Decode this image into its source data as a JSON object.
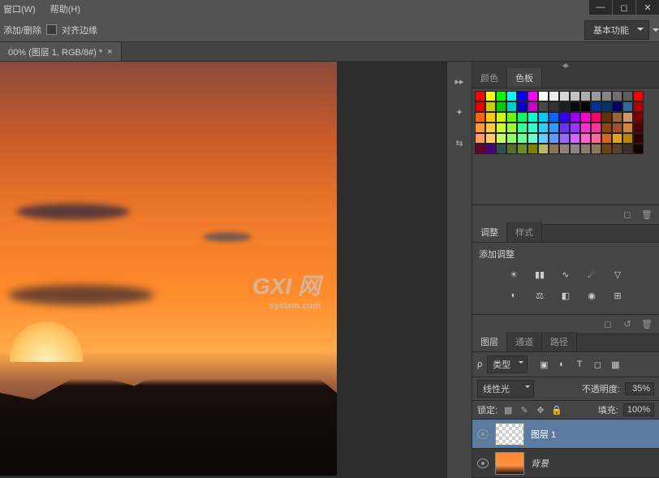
{
  "menu": {
    "window": "窗口(W)",
    "help": "帮助(H)"
  },
  "options": {
    "add_remove": "添加/删除",
    "align_edges": "对齐边缘"
  },
  "workspace": "基本功能",
  "doc_tab": "00% (图层 1, RGB/8#) *",
  "watermark": {
    "main": "GXI 网",
    "sub": "system.com"
  },
  "panels": {
    "color": "颜色",
    "swatches": "色板",
    "adjust": "调整",
    "styles": "样式",
    "add_adjust": "添加调整",
    "layers": "图层",
    "channels": "通道",
    "paths": "路径"
  },
  "layer_ctrl": {
    "kind_label": "ρ",
    "kind": "类型",
    "blend": "线性光",
    "opacity_label": "不透明度:",
    "opacity": "35%",
    "lock_label": "锁定:",
    "fill_label": "填充:",
    "fill": "100%"
  },
  "layers": [
    {
      "name": "图层 1",
      "sel": true,
      "thumb": "checker"
    },
    {
      "name": "背景",
      "sel": false,
      "thumb": "bg"
    }
  ],
  "swatches_colors": [
    "#ff0000",
    "#ffff00",
    "#00ff00",
    "#00ffff",
    "#0000ff",
    "#ff00ff",
    "#ffffff",
    "#ebebeb",
    "#d6d6d6",
    "#c2c2c2",
    "#adadad",
    "#999999",
    "#858585",
    "#707070",
    "#5c5c5c",
    "#ff0000",
    "#e60000",
    "#cccc00",
    "#00cc00",
    "#00cccc",
    "#0000cc",
    "#cc00cc",
    "#474747",
    "#333333",
    "#1f1f1f",
    "#0a0a0a",
    "#000000",
    "#003399",
    "#003366",
    "#000066",
    "#336699",
    "#b30000",
    "#ff6600",
    "#ffcc00",
    "#ccff00",
    "#66ff00",
    "#00ff66",
    "#00ffcc",
    "#00ccff",
    "#0066ff",
    "#3300ff",
    "#9900ff",
    "#ff00cc",
    "#ff0066",
    "#663300",
    "#996633",
    "#cc9966",
    "#800000",
    "#ff9933",
    "#ffcc33",
    "#ccff33",
    "#99ff33",
    "#33ff99",
    "#33ffcc",
    "#33ccff",
    "#3399ff",
    "#6633ff",
    "#9933ff",
    "#ff33cc",
    "#ff3399",
    "#8b4513",
    "#a0522d",
    "#cd853f",
    "#4d0000",
    "#ff9966",
    "#ffcc66",
    "#ccff66",
    "#99ff66",
    "#66ff99",
    "#66ffcc",
    "#66ccff",
    "#6699ff",
    "#9966ff",
    "#cc66ff",
    "#ff66cc",
    "#ff6699",
    "#d2691e",
    "#daa520",
    "#b8860b",
    "#330000",
    "#660033",
    "#4b0082",
    "#2f4f4f",
    "#556b2f",
    "#6b8e23",
    "#808000",
    "#bdb76b",
    "#8b7355",
    "#8b8378",
    "#8b8682",
    "#8b7d6b",
    "#8b795e",
    "#704214",
    "#5c4033",
    "#3b2f2f",
    "#1a0000"
  ]
}
